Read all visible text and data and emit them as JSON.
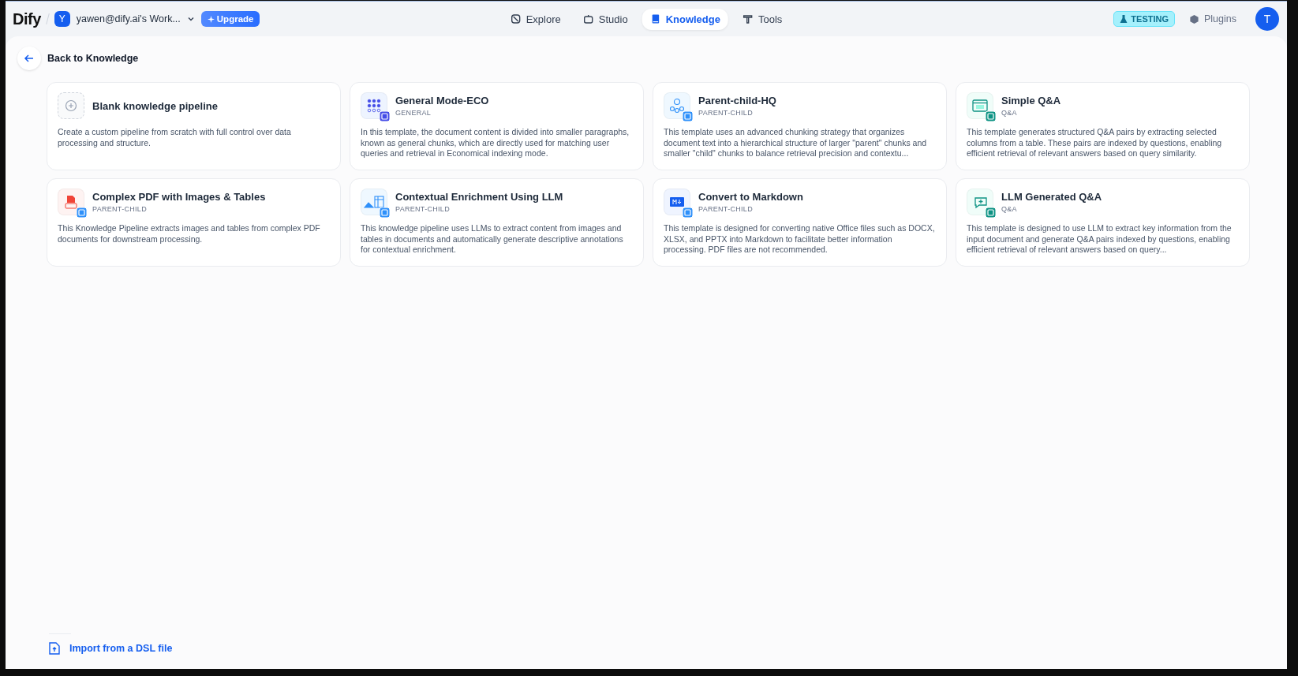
{
  "header": {
    "logo": "Dify",
    "workspace": {
      "initial": "Y",
      "name": "yawen@dify.ai's Work..."
    },
    "upgrade": "Upgrade",
    "nav": [
      {
        "label": "Explore",
        "kind": "explore",
        "selected": false
      },
      {
        "label": "Studio",
        "kind": "studio",
        "selected": false
      },
      {
        "label": "Knowledge",
        "kind": "knowledge",
        "selected": true
      },
      {
        "label": "Tools",
        "kind": "tools",
        "selected": false
      }
    ],
    "env_badge": "TESTING",
    "plugins": "Plugins",
    "avatar": "T"
  },
  "back": "Back to Knowledge",
  "templates": [
    {
      "kind": "blank",
      "title": "Blank knowledge pipeline",
      "description": "Create a custom pipeline from scratch with full control over data processing and structure."
    },
    {
      "kind": "general",
      "title": "General Mode-ECO",
      "tag": "GENERAL",
      "description": "In this template, the document content is divided into smaller paragraphs, known as general chunks, which are directly used for matching user queries and retrieval in Economical indexing mode."
    },
    {
      "kind": "parent-child",
      "title": "Parent-child-HQ",
      "tag": "PARENT-CHILD",
      "description": "This template uses an advanced chunking strategy that organizes document text into a hierarchical structure of larger \"parent\" chunks and smaller \"child\" chunks to balance retrieval precision and contextu..."
    },
    {
      "kind": "qa",
      "title": "Simple Q&A",
      "tag": "Q&A",
      "description": "This template generates structured Q&A pairs by extracting selected columns from a table. These pairs are indexed by questions, enabling efficient retrieval of relevant answers based on query similarity."
    },
    {
      "kind": "pdf",
      "title": "Complex PDF with Images & Tables",
      "tag": "PARENT-CHILD",
      "description": "This Knowledge Pipeline extracts images and tables from complex PDF documents for downstream processing."
    },
    {
      "kind": "image",
      "title": "Contextual Enrichment Using LLM",
      "tag": "PARENT-CHILD",
      "description": "This knowledge pipeline uses LLMs to extract content from images and tables in documents and automatically generate descriptive annotations for contextual enrichment."
    },
    {
      "kind": "markdown",
      "title": "Convert to Markdown",
      "tag": "PARENT-CHILD",
      "description": "This template is designed for converting native Office files such as DOCX, XLSX, and PPTX into Markdown to facilitate better information processing. PDF files are not recommended."
    },
    {
      "kind": "llm",
      "title": "LLM Generated Q&A",
      "tag": "Q&A",
      "description": "This template is designed to use LLM to extract key information from the input document and generate Q&A pairs indexed by questions, enabling efficient retrieval of relevant answers based on query..."
    }
  ],
  "import": "Import from a DSL file"
}
